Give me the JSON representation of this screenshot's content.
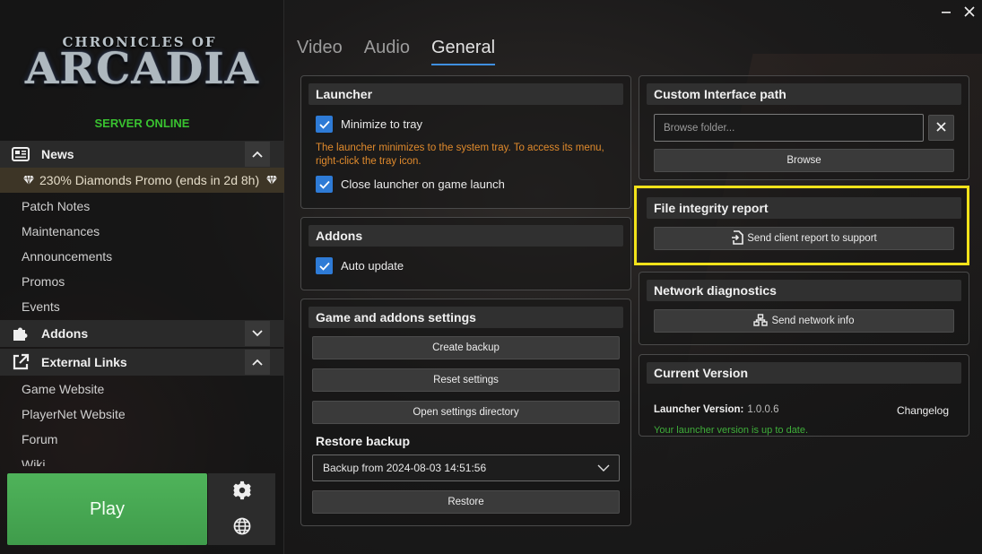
{
  "window": {
    "minimize_icon": "minimize-icon",
    "close_icon": "close-icon"
  },
  "brand": {
    "logo_small": "CHRONICLES OF",
    "logo_big": "ARCADIA",
    "server_status": "SERVER ONLINE"
  },
  "sidebar": {
    "news": {
      "label": "News",
      "promo": "230% Diamonds Promo (ends in 2d 8h)",
      "items": [
        "Patch Notes",
        "Maintenances",
        "Announcements",
        "Promos",
        "Events"
      ]
    },
    "addons": {
      "label": "Addons"
    },
    "external_links": {
      "label": "External Links",
      "items": [
        "Game Website",
        "PlayerNet Website",
        "Forum",
        "Wiki"
      ]
    },
    "play_label": "Play"
  },
  "tabs": [
    {
      "label": "Video",
      "active": false
    },
    {
      "label": "Audio",
      "active": false
    },
    {
      "label": "General",
      "active": true
    }
  ],
  "launcher": {
    "title": "Launcher",
    "minimize_to_tray": "Minimize to tray",
    "tray_note_line1": "The launcher minimizes to the system tray. To access its menu,",
    "tray_note_line2": "right-click the tray icon.",
    "close_on_launch": "Close launcher on game launch"
  },
  "addons_panel": {
    "title": "Addons",
    "auto_update": "Auto update"
  },
  "game_settings": {
    "title": "Game and addons settings",
    "create_backup": "Create backup",
    "reset_settings": "Reset settings",
    "open_settings_dir": "Open settings directory",
    "restore_title": "Restore backup",
    "backup_selected": "Backup from 2024-08-03 14:51:56",
    "restore": "Restore"
  },
  "custom_interface": {
    "title": "Custom Interface path",
    "placeholder": "Browse folder...",
    "browse": "Browse"
  },
  "file_integrity": {
    "title": "File integrity report",
    "send": "Send client report to support"
  },
  "network": {
    "title": "Network diagnostics",
    "send": "Send network info"
  },
  "version": {
    "title": "Current Version",
    "label": "Launcher Version:",
    "value": "1.0.0.6",
    "changelog": "Changelog",
    "status": "Your launcher version is up to date."
  },
  "colors": {
    "accent": "#2e7bd6",
    "online": "#39c230",
    "play": "#4fb35a",
    "warning": "#e08a2c",
    "highlight": "#f2e21a"
  }
}
